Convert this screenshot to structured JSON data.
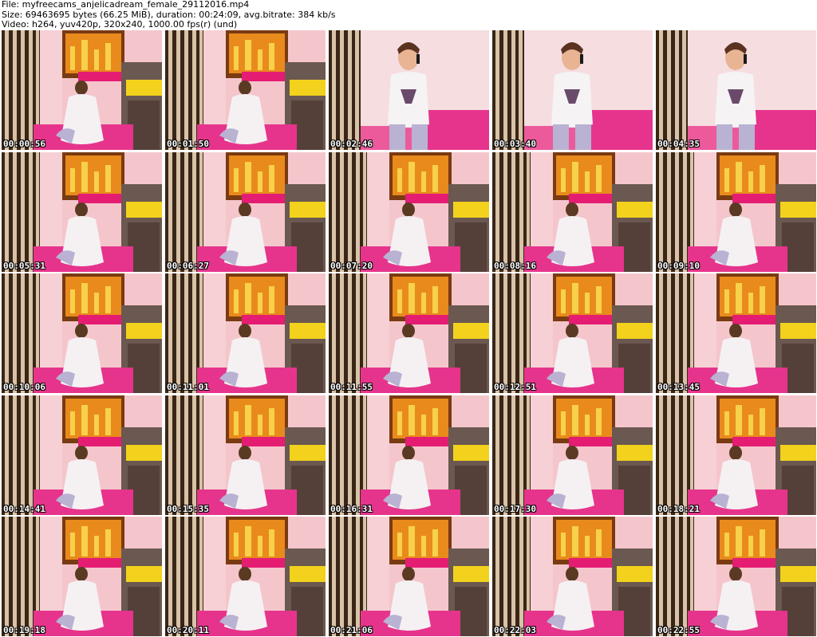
{
  "header": {
    "file_line": "File: myfreecams_anjelicadream_female_29112016.mp4",
    "size_line": "Size: 69463695 bytes (66.25 MiB), duration: 00:24:09, avg.bitrate: 384 kb/s",
    "video_line": "Video: h264, yuv420p, 320x240, 1000.00 fps(r) (und)"
  },
  "thumbnails": [
    {
      "time": "00:00:56",
      "scene": "back"
    },
    {
      "time": "00:01:50",
      "scene": "back"
    },
    {
      "time": "00:02:46",
      "scene": "phone"
    },
    {
      "time": "00:03:40",
      "scene": "phone"
    },
    {
      "time": "00:04:35",
      "scene": "phone"
    },
    {
      "time": "00:05:31",
      "scene": "back"
    },
    {
      "time": "00:06:27",
      "scene": "back"
    },
    {
      "time": "00:07:20",
      "scene": "back"
    },
    {
      "time": "00:08:16",
      "scene": "back"
    },
    {
      "time": "00:09:10",
      "scene": "back"
    },
    {
      "time": "00:10:06",
      "scene": "back"
    },
    {
      "time": "00:11:01",
      "scene": "back"
    },
    {
      "time": "00:11:55",
      "scene": "back"
    },
    {
      "time": "00:12:51",
      "scene": "back"
    },
    {
      "time": "00:13:45",
      "scene": "back"
    },
    {
      "time": "00:14:41",
      "scene": "back"
    },
    {
      "time": "00:15:35",
      "scene": "back"
    },
    {
      "time": "00:16:31",
      "scene": "back"
    },
    {
      "time": "00:17:30",
      "scene": "back"
    },
    {
      "time": "00:18:21",
      "scene": "back"
    },
    {
      "time": "00:19:18",
      "scene": "back"
    },
    {
      "time": "00:20:11",
      "scene": "back"
    },
    {
      "time": "00:21:06",
      "scene": "back"
    },
    {
      "time": "00:22:03",
      "scene": "back"
    },
    {
      "time": "00:22:55",
      "scene": "back"
    }
  ]
}
